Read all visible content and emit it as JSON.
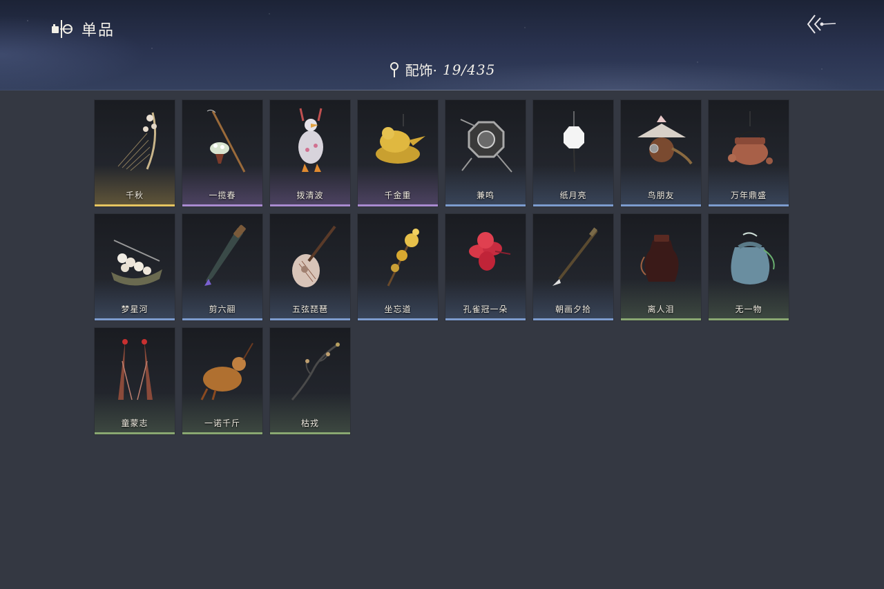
{
  "header": {
    "title": "单品",
    "title_icon": "wardrobe-icon",
    "back_icon": "back-arrow-icon"
  },
  "category": {
    "icon": "pin-icon",
    "label": "配饰·",
    "count": "19/435"
  },
  "quality_colors": {
    "gold": "#e6c560",
    "purple": "#a98bd0",
    "blue": "#7d9ccf",
    "green": "#8aa872"
  },
  "items": [
    {
      "name": "千秋",
      "quality": "gold",
      "icon": "flower-harp-icon"
    },
    {
      "name": "一揽春",
      "quality": "purple",
      "icon": "flower-basket-pole-icon"
    },
    {
      "name": "拨清波",
      "quality": "purple",
      "icon": "duck-icon"
    },
    {
      "name": "千金重",
      "quality": "purple",
      "icon": "golden-bird-icon"
    },
    {
      "name": "兼鸣",
      "quality": "blue",
      "icon": "octagon-shield-icon"
    },
    {
      "name": "纸月亮",
      "quality": "blue",
      "icon": "paper-moon-icon"
    },
    {
      "name": "鸟朋友",
      "quality": "blue",
      "icon": "bird-house-icon"
    },
    {
      "name": "万年鼎盛",
      "quality": "blue",
      "icon": "cauldron-turtle-icon"
    },
    {
      "name": "梦星河",
      "quality": "blue",
      "icon": "flower-boat-icon"
    },
    {
      "name": "剪六翮",
      "quality": "blue",
      "icon": "dagger-icon"
    },
    {
      "name": "五弦琵琶",
      "quality": "blue",
      "icon": "pipa-icon"
    },
    {
      "name": "坐忘道",
      "quality": "blue",
      "icon": "golden-flower-staff-icon"
    },
    {
      "name": "孔雀冠一朵",
      "quality": "blue",
      "icon": "red-flower-icon"
    },
    {
      "name": "朝画夕拾",
      "quality": "blue",
      "icon": "brush-icon"
    },
    {
      "name": "离人泪",
      "quality": "green",
      "icon": "wine-jar-icon"
    },
    {
      "name": "无一物",
      "quality": "green",
      "icon": "cloth-pouch-icon"
    },
    {
      "name": "童蒙志",
      "quality": "green",
      "icon": "feather-pair-icon"
    },
    {
      "name": "一诺千斤",
      "quality": "green",
      "icon": "roast-bird-icon"
    },
    {
      "name": "枯戎",
      "quality": "green",
      "icon": "dry-branch-icon"
    }
  ]
}
